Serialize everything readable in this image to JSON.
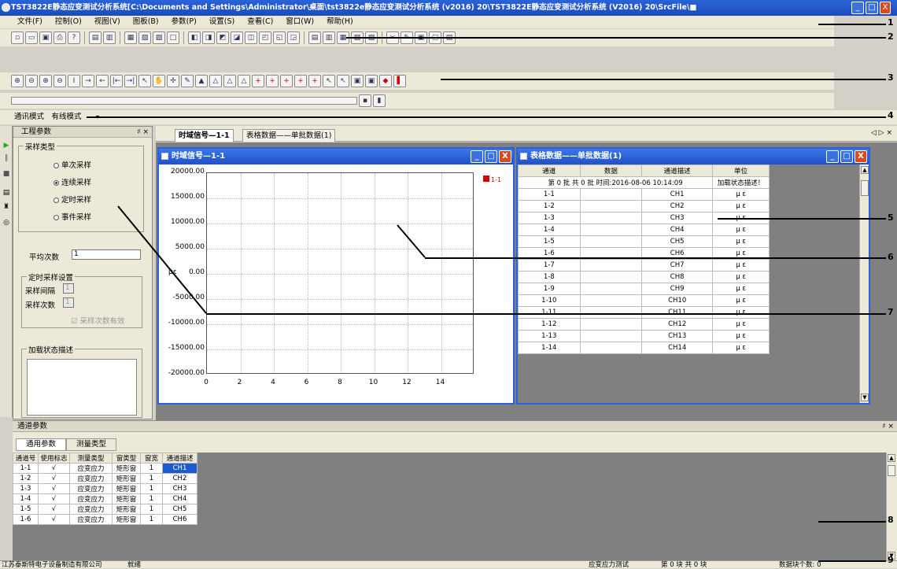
{
  "window": {
    "title": "TST3822E静态应变测试分析系统[C:\\Documents and Settings\\Administrator\\桌面\\tst3822e静态应变测试分析系统 (v2016)  20\\TST3822E静态应变测试分析系统 (V2016)  20\\SrcFile\\■",
    "min": "_",
    "max": "□",
    "close": "X"
  },
  "menu": [
    "文件(F)",
    "控制(O)",
    "视图(V)",
    "图板(B)",
    "参数(P)",
    "设置(S)",
    "查看(C)",
    "窗口(W)",
    "帮助(H)"
  ],
  "comm": {
    "label": "通讯模式",
    "value": "有线模式"
  },
  "work_panel": {
    "title": "工程参数",
    "pin": "♯ ×",
    "sample_group": "采样类型",
    "sample_options": [
      "单次采样",
      "连续采样",
      "定时采样",
      "事件采样"
    ],
    "selected_index": 1,
    "avg_label": "平均次数",
    "avg_value": "1",
    "timed_group": "定时采样设置",
    "interval_label": "采样间隔",
    "interval_value": "1",
    "count_label": "采样次数",
    "count_value": "1",
    "count_valid": "采样次数有效",
    "load_desc_label": "加载状态描述"
  },
  "doc_tabs": [
    "时域信号—1-1",
    "表格数据——单批数据(1)"
  ],
  "doc_nav": "◁ ▷ ×",
  "plot_window": {
    "title": "时域信号—1-1",
    "legend": "1-1",
    "yticks": [
      "20000.00",
      "15000.00",
      "10000.00",
      "5000.00",
      "0.00",
      "-5000.00",
      "-10000.00",
      "-15000.00",
      "-20000.00"
    ],
    "xticks": [
      "0",
      "2",
      "4",
      "6",
      "8",
      "10",
      "12",
      "14"
    ],
    "ylabel": "με"
  },
  "chart_data": {
    "type": "line",
    "title": "",
    "xlabel": "",
    "ylabel": "με",
    "xlim": [
      0,
      16
    ],
    "ylim": [
      -20000,
      20000
    ],
    "grid": true,
    "series": [
      {
        "name": "1-1",
        "values": []
      }
    ],
    "legend_position": "top-right"
  },
  "table_window": {
    "title": "表格数据——单批数据(1)",
    "headers": [
      "通道",
      "数据",
      "通道描述",
      "单位"
    ],
    "info": "第 0 批  共 0 批  时间:2016-08-06 10:14:09",
    "info_extra": "加载状态描述！",
    "rows": [
      [
        "1-1",
        "",
        "CH1",
        "μ ε"
      ],
      [
        "1-2",
        "",
        "CH2",
        "μ ε"
      ],
      [
        "1-3",
        "",
        "CH3",
        "μ ε"
      ],
      [
        "1-4",
        "",
        "CH4",
        "μ ε"
      ],
      [
        "1-5",
        "",
        "CH5",
        "μ ε"
      ],
      [
        "1-6",
        "",
        "CH6",
        "μ ε"
      ],
      [
        "1-7",
        "",
        "CH7",
        "μ ε"
      ],
      [
        "1-8",
        "",
        "CH8",
        "μ ε"
      ],
      [
        "1-9",
        "",
        "CH9",
        "μ ε"
      ],
      [
        "1-10",
        "",
        "CH10",
        "μ ε"
      ],
      [
        "1-11",
        "",
        "CH11",
        "μ ε"
      ],
      [
        "1-12",
        "",
        "CH12",
        "μ ε"
      ],
      [
        "1-13",
        "",
        "CH13",
        "μ ε"
      ],
      [
        "1-14",
        "",
        "CH14",
        "μ ε"
      ]
    ]
  },
  "channel_panel": {
    "title": "通道参数",
    "pin": "♯ ×",
    "tabs": [
      "通用参数",
      "测量类型"
    ],
    "headers": [
      "通道号",
      "使用标志",
      "测量类型",
      "窗类型",
      "窗宽",
      "通道描述"
    ],
    "rows": [
      [
        "1-1",
        "√",
        "应变应力",
        "矩形窗",
        "1",
        "CH1"
      ],
      [
        "1-2",
        "√",
        "应变应力",
        "矩形窗",
        "1",
        "CH2"
      ],
      [
        "1-3",
        "√",
        "应变应力",
        "矩形窗",
        "1",
        "CH3"
      ],
      [
        "1-4",
        "√",
        "应变应力",
        "矩形窗",
        "1",
        "CH4"
      ],
      [
        "1-5",
        "√",
        "应变应力",
        "矩形窗",
        "1",
        "CH5"
      ],
      [
        "1-6",
        "√",
        "应变应力",
        "矩形窗",
        "1",
        "CH6"
      ]
    ]
  },
  "status": {
    "company": "江苏泰斯特电子设备制造有限公司",
    "ready": "就绪",
    "mode": "应变应力测试",
    "batch": "第 0 块  共 0 块",
    "count": "数据块个数: 0"
  },
  "callouts": [
    "1",
    "2",
    "3",
    "4",
    "5",
    "6",
    "7",
    "8",
    "9"
  ]
}
